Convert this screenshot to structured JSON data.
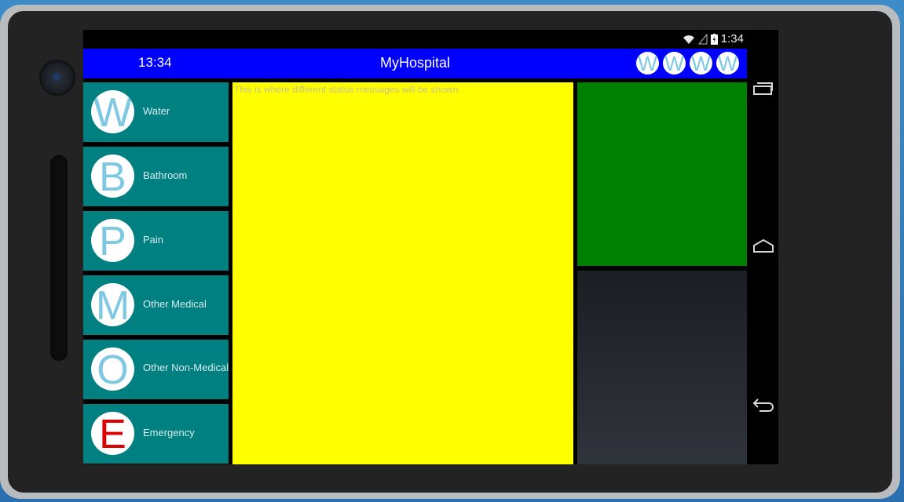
{
  "status_bar": {
    "time": "1:34"
  },
  "app_bar": {
    "clock": "13:34",
    "title": "MyHospital",
    "badges": [
      "W",
      "W",
      "W",
      "W"
    ]
  },
  "sidebar": {
    "items": [
      {
        "letter": "W",
        "label": "Water"
      },
      {
        "letter": "B",
        "label": "Bathroom"
      },
      {
        "letter": "P",
        "label": "Pain"
      },
      {
        "letter": "M",
        "label": "Other Medical"
      },
      {
        "letter": "O",
        "label": "Other Non-Medical"
      },
      {
        "letter": "E",
        "label": "Emergency"
      }
    ]
  },
  "status_panel": {
    "message": "This is where different status messages will be shown."
  },
  "colors": {
    "app_bar": "#0000ff",
    "sidebar_button": "#008080",
    "status_panel": "#ffff00",
    "green_panel": "#008000",
    "icon_letter": "#7ec8e3",
    "emergency_letter": "#e00000"
  },
  "icons": {
    "status": [
      "wifi-icon",
      "cellular-signal-icon",
      "battery-charging-icon"
    ],
    "navigation": [
      "recent-apps-icon",
      "home-icon",
      "back-icon"
    ]
  }
}
